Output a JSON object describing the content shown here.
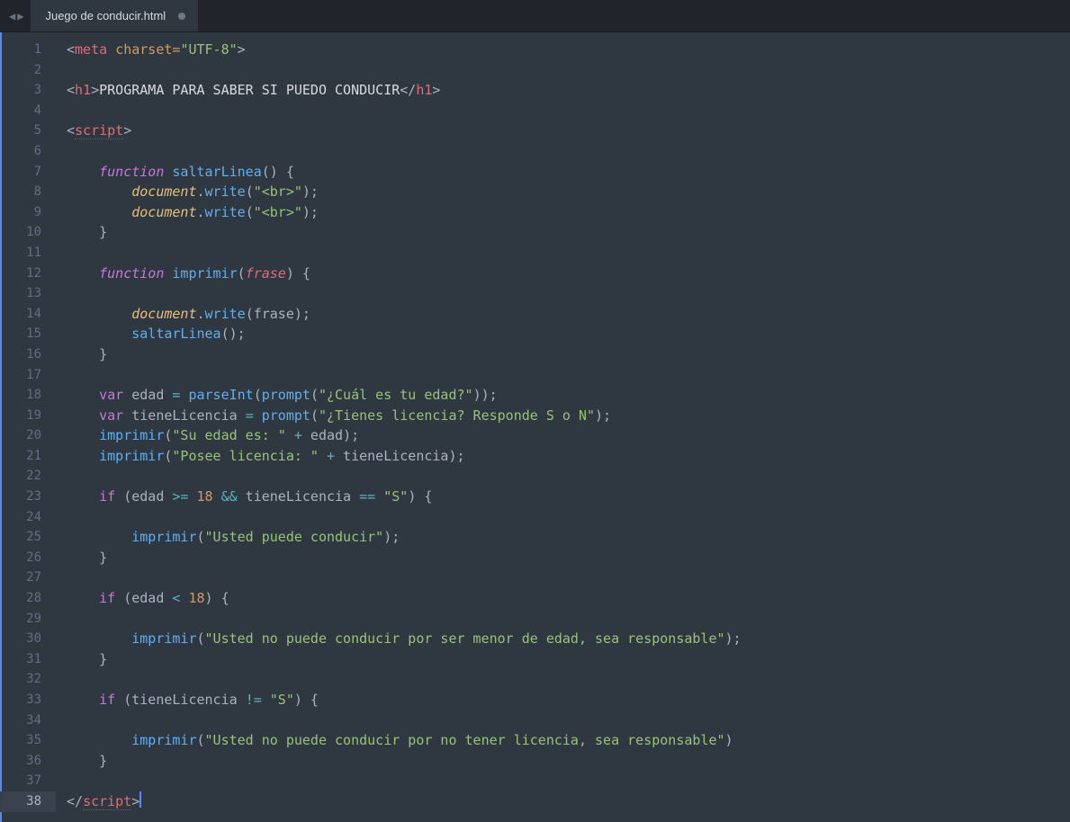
{
  "tab": {
    "filename": "Juego de conducir.html",
    "dirty": true
  },
  "gutter": {
    "start": 1,
    "end": 38,
    "active": 38
  },
  "code": {
    "lines": [
      {
        "n": 1,
        "t": [
          [
            "tagang",
            "<"
          ],
          [
            "tag",
            "meta"
          ],
          [
            "plain",
            " "
          ],
          [
            "attr",
            "charset="
          ],
          [
            "str",
            "\"UTF-8\""
          ],
          [
            "tagang",
            ">"
          ]
        ]
      },
      {
        "n": 2,
        "t": []
      },
      {
        "n": 3,
        "t": [
          [
            "tagang",
            "<"
          ],
          [
            "tag",
            "h1"
          ],
          [
            "tagang",
            ">"
          ],
          [
            "plainw",
            "PROGRAMA PARA SABER SI PUEDO CONDUCIR"
          ],
          [
            "tagang",
            "</"
          ],
          [
            "tag",
            "h1"
          ],
          [
            "tagang",
            ">"
          ]
        ]
      },
      {
        "n": 4,
        "t": []
      },
      {
        "n": 5,
        "t": [
          [
            "tagang",
            "<"
          ],
          [
            "tag",
            "script",
            "u"
          ],
          [
            "tagang",
            ">"
          ]
        ]
      },
      {
        "n": 6,
        "t": []
      },
      {
        "n": 7,
        "t": [
          [
            "plain",
            "    "
          ],
          [
            "kw",
            "function"
          ],
          [
            "plain",
            " "
          ],
          [
            "fnname",
            "saltarLinea"
          ],
          [
            "paren",
            "() {"
          ]
        ]
      },
      {
        "n": 8,
        "t": [
          [
            "plain",
            "        "
          ],
          [
            "obj",
            "document"
          ],
          [
            "punc",
            "."
          ],
          [
            "fncall",
            "write"
          ],
          [
            "paren",
            "("
          ],
          [
            "str",
            "\"<br>\""
          ],
          [
            "paren",
            ");"
          ]
        ]
      },
      {
        "n": 9,
        "t": [
          [
            "plain",
            "        "
          ],
          [
            "obj",
            "document"
          ],
          [
            "punc",
            "."
          ],
          [
            "fncall",
            "write"
          ],
          [
            "paren",
            "("
          ],
          [
            "str",
            "\"<br>\""
          ],
          [
            "paren",
            ");"
          ]
        ]
      },
      {
        "n": 10,
        "t": [
          [
            "plain",
            "    "
          ],
          [
            "paren",
            "}"
          ]
        ]
      },
      {
        "n": 11,
        "t": []
      },
      {
        "n": 12,
        "t": [
          [
            "plain",
            "    "
          ],
          [
            "kw",
            "function"
          ],
          [
            "plain",
            " "
          ],
          [
            "fnname",
            "imprimir"
          ],
          [
            "paren",
            "("
          ],
          [
            "param",
            "frase"
          ],
          [
            "paren",
            ") {"
          ]
        ]
      },
      {
        "n": 13,
        "t": []
      },
      {
        "n": 14,
        "t": [
          [
            "plain",
            "        "
          ],
          [
            "obj",
            "document"
          ],
          [
            "punc",
            "."
          ],
          [
            "fncall",
            "write"
          ],
          [
            "paren",
            "("
          ],
          [
            "plain",
            "frase"
          ],
          [
            "paren",
            ");"
          ]
        ]
      },
      {
        "n": 15,
        "t": [
          [
            "plain",
            "        "
          ],
          [
            "fncall",
            "saltarLinea"
          ],
          [
            "paren",
            "();"
          ]
        ]
      },
      {
        "n": 16,
        "t": [
          [
            "plain",
            "    "
          ],
          [
            "paren",
            "}"
          ]
        ]
      },
      {
        "n": 17,
        "t": []
      },
      {
        "n": 18,
        "t": [
          [
            "plain",
            "    "
          ],
          [
            "kw-n",
            "var"
          ],
          [
            "plain",
            " "
          ],
          [
            "plain",
            "edad "
          ],
          [
            "op",
            "="
          ],
          [
            "plain",
            " "
          ],
          [
            "fncall",
            "parseInt"
          ],
          [
            "paren",
            "("
          ],
          [
            "fncall",
            "prompt"
          ],
          [
            "paren",
            "("
          ],
          [
            "str",
            "\"¿Cuál es tu edad?\""
          ],
          [
            "paren",
            "));"
          ]
        ]
      },
      {
        "n": 19,
        "t": [
          [
            "plain",
            "    "
          ],
          [
            "kw-n",
            "var"
          ],
          [
            "plain",
            " "
          ],
          [
            "plain",
            "tieneLicencia "
          ],
          [
            "op",
            "="
          ],
          [
            "plain",
            " "
          ],
          [
            "fncall",
            "prompt"
          ],
          [
            "paren",
            "("
          ],
          [
            "str",
            "\"¿Tienes licencia? Responde S o N\""
          ],
          [
            "paren",
            ");"
          ]
        ]
      },
      {
        "n": 20,
        "t": [
          [
            "plain",
            "    "
          ],
          [
            "fncall",
            "imprimir"
          ],
          [
            "paren",
            "("
          ],
          [
            "str",
            "\"Su edad es: \""
          ],
          [
            "plain",
            " "
          ],
          [
            "op",
            "+"
          ],
          [
            "plain",
            " edad"
          ],
          [
            "paren",
            ");"
          ]
        ]
      },
      {
        "n": 21,
        "t": [
          [
            "plain",
            "    "
          ],
          [
            "fncall",
            "imprimir"
          ],
          [
            "paren",
            "("
          ],
          [
            "str",
            "\"Posee licencia: \""
          ],
          [
            "plain",
            " "
          ],
          [
            "op",
            "+"
          ],
          [
            "plain",
            " tieneLicencia"
          ],
          [
            "paren",
            ");"
          ]
        ]
      },
      {
        "n": 22,
        "t": []
      },
      {
        "n": 23,
        "t": [
          [
            "plain",
            "    "
          ],
          [
            "kw-n",
            "if"
          ],
          [
            "plain",
            " "
          ],
          [
            "paren",
            "("
          ],
          [
            "plain",
            "edad "
          ],
          [
            "op",
            ">="
          ],
          [
            "plain",
            " "
          ],
          [
            "num",
            "18"
          ],
          [
            "plain",
            " "
          ],
          [
            "op",
            "&&"
          ],
          [
            "plain",
            " tieneLicencia "
          ],
          [
            "op",
            "=="
          ],
          [
            "plain",
            " "
          ],
          [
            "str",
            "\"S\""
          ],
          [
            "paren",
            ") {"
          ]
        ]
      },
      {
        "n": 24,
        "t": []
      },
      {
        "n": 25,
        "t": [
          [
            "plain",
            "        "
          ],
          [
            "fncall",
            "imprimir"
          ],
          [
            "paren",
            "("
          ],
          [
            "str",
            "\"Usted puede conducir\""
          ],
          [
            "paren",
            ");"
          ]
        ]
      },
      {
        "n": 26,
        "t": [
          [
            "plain",
            "    "
          ],
          [
            "paren",
            "}"
          ]
        ]
      },
      {
        "n": 27,
        "t": []
      },
      {
        "n": 28,
        "t": [
          [
            "plain",
            "    "
          ],
          [
            "kw-n",
            "if"
          ],
          [
            "plain",
            " "
          ],
          [
            "paren",
            "("
          ],
          [
            "plain",
            "edad "
          ],
          [
            "op",
            "<"
          ],
          [
            "plain",
            " "
          ],
          [
            "num",
            "18"
          ],
          [
            "paren",
            ") {"
          ]
        ]
      },
      {
        "n": 29,
        "t": []
      },
      {
        "n": 30,
        "t": [
          [
            "plain",
            "        "
          ],
          [
            "fncall",
            "imprimir"
          ],
          [
            "paren",
            "("
          ],
          [
            "str",
            "\"Usted no puede conducir por ser menor de edad, sea responsable\""
          ],
          [
            "paren",
            ");"
          ]
        ]
      },
      {
        "n": 31,
        "t": [
          [
            "plain",
            "    "
          ],
          [
            "paren",
            "}"
          ]
        ]
      },
      {
        "n": 32,
        "t": []
      },
      {
        "n": 33,
        "t": [
          [
            "plain",
            "    "
          ],
          [
            "kw-n",
            "if"
          ],
          [
            "plain",
            " "
          ],
          [
            "paren",
            "("
          ],
          [
            "plain",
            "tieneLicencia "
          ],
          [
            "op",
            "!="
          ],
          [
            "plain",
            " "
          ],
          [
            "str",
            "\"S\""
          ],
          [
            "paren",
            ") {"
          ]
        ]
      },
      {
        "n": 34,
        "t": []
      },
      {
        "n": 35,
        "t": [
          [
            "plain",
            "        "
          ],
          [
            "fncall",
            "imprimir"
          ],
          [
            "paren",
            "("
          ],
          [
            "str",
            "\"Usted no puede conducir por no tener licencia, sea responsable\""
          ],
          [
            "paren",
            ")"
          ]
        ]
      },
      {
        "n": 36,
        "t": [
          [
            "plain",
            "    "
          ],
          [
            "paren",
            "}"
          ]
        ]
      },
      {
        "n": 37,
        "t": []
      },
      {
        "n": 38,
        "t": [
          [
            "tagang",
            "</"
          ],
          [
            "tag",
            "script",
            "u"
          ],
          [
            "tagang",
            ">"
          ],
          [
            "cursor",
            ""
          ]
        ]
      }
    ]
  }
}
